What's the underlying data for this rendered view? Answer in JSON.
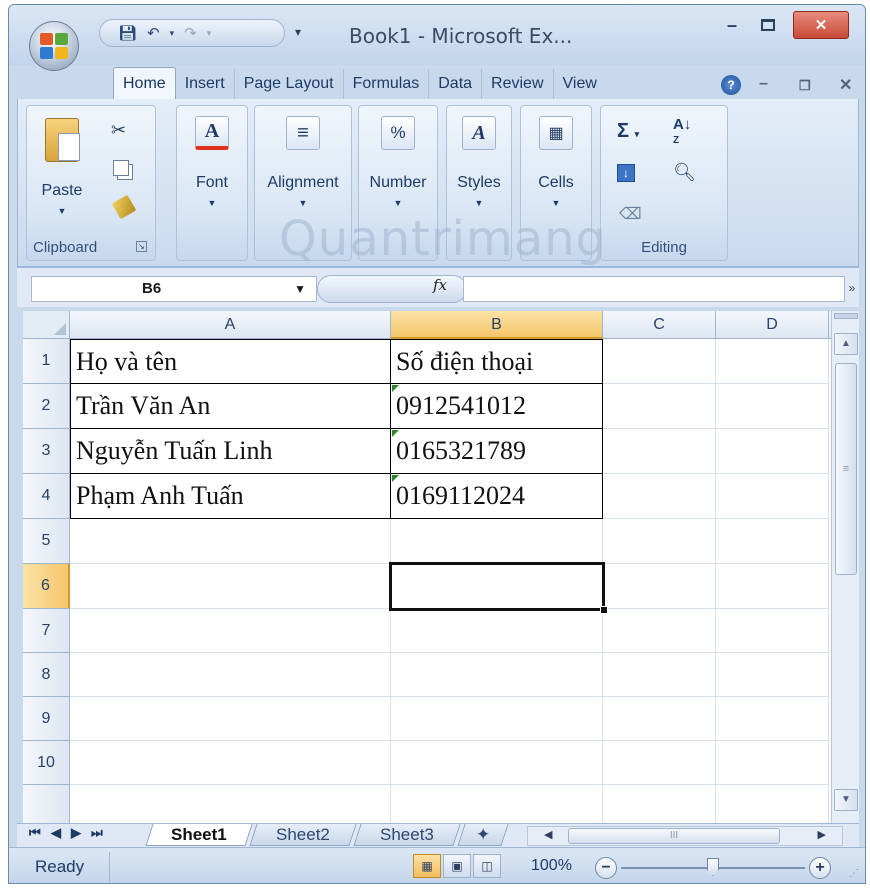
{
  "window": {
    "title": "Book1 - Microsoft Ex...",
    "minimize_label": "–",
    "close_label": "✕"
  },
  "quick_access": {
    "save_icon": "save-icon",
    "undo_icon": "undo-icon",
    "redo_icon": "redo-icon",
    "customize_icon": "dropdown-icon"
  },
  "tabs": [
    "Home",
    "Insert",
    "Page Layout",
    "Formulas",
    "Data",
    "Review",
    "View"
  ],
  "active_tab": "Home",
  "ribbon": {
    "clipboard": {
      "label": "Clipboard",
      "paste": "Paste"
    },
    "font": {
      "label": "Font"
    },
    "alignment": {
      "label": "Alignment"
    },
    "number": {
      "label": "Number"
    },
    "styles": {
      "label": "Styles"
    },
    "cells": {
      "label": "Cells"
    },
    "editing": {
      "label": "Editing"
    }
  },
  "formula_bar": {
    "name_box": "B6",
    "fx": "fx",
    "formula": ""
  },
  "columns": [
    "A",
    "B",
    "C",
    "D"
  ],
  "selected_column": "B",
  "rows": [
    "1",
    "2",
    "3",
    "4",
    "5",
    "6",
    "7",
    "8",
    "9",
    "10"
  ],
  "selected_row": "6",
  "cells": {
    "A1": "Họ và tên",
    "B1": "Số điện thoại",
    "A2": "Trần Văn An",
    "B2": "0912541012",
    "A3": "Nguyễn Tuấn Linh",
    "B3": "0165321789",
    "A4": "Phạm Anh Tuấn",
    "B4": "0169112024"
  },
  "active_cell": "B6",
  "sheets": [
    "Sheet1",
    "Sheet2",
    "Sheet3"
  ],
  "active_sheet": "Sheet1",
  "status": {
    "text": "Ready",
    "zoom": "100%"
  },
  "watermark": "Quantrimang",
  "colors": {
    "accent": "#f6c56b",
    "ribbon": "#d9e6f4",
    "error_marker": "#2a8a2a"
  }
}
